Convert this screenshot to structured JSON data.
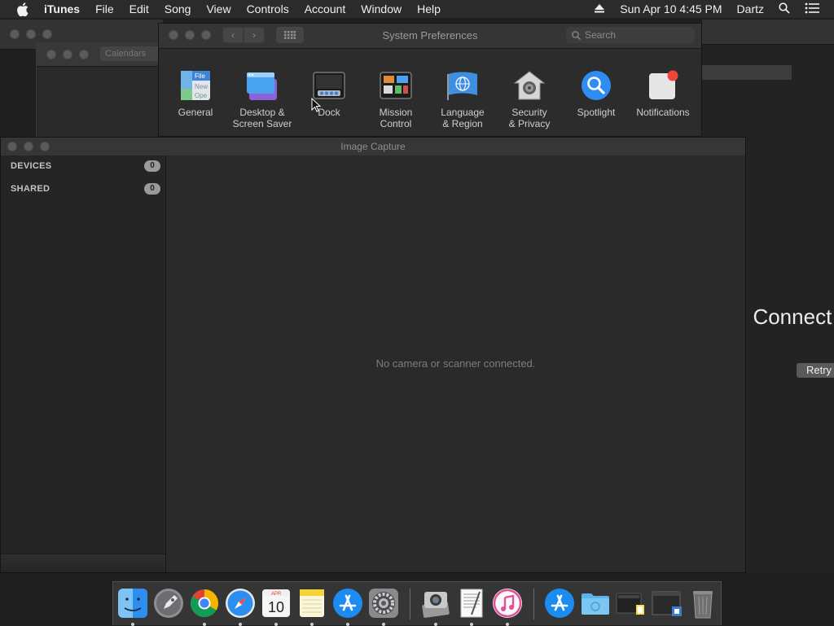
{
  "menubar": {
    "app_name": "iTunes",
    "items": [
      "File",
      "Edit",
      "Song",
      "View",
      "Controls",
      "Account",
      "Window",
      "Help"
    ],
    "datetime": "Sun Apr 10  4:45 PM",
    "user": "Dartz"
  },
  "background": {
    "calendar_field": "Calendars",
    "connect_text": ": Connect",
    "retry_label": "Retry"
  },
  "syspref": {
    "title": "System Preferences",
    "search_placeholder": "Search",
    "items": [
      {
        "label": "General",
        "icon": "general-icon"
      },
      {
        "label": "Desktop &\nScreen Saver",
        "icon": "desktop-icon"
      },
      {
        "label": "Dock",
        "icon": "dock-icon"
      },
      {
        "label": "Mission\nControl",
        "icon": "mission-control-icon"
      },
      {
        "label": "Language\n& Region",
        "icon": "language-icon"
      },
      {
        "label": "Security\n& Privacy",
        "icon": "security-icon"
      },
      {
        "label": "Spotlight",
        "icon": "spotlight-icon"
      },
      {
        "label": "Notifications",
        "icon": "notifications-icon"
      }
    ]
  },
  "imagecapture": {
    "title": "Image Capture",
    "sections": [
      {
        "label": "DEVICES",
        "count": "0"
      },
      {
        "label": "SHARED",
        "count": "0"
      }
    ],
    "empty_message": "No camera or scanner connected."
  },
  "dock": {
    "items": [
      "finder-icon",
      "launchpad-icon",
      "chrome-icon",
      "safari-icon",
      "calendar-icon",
      "notes-icon",
      "app-store-icon",
      "system-preferences-icon",
      "image-capture-icon",
      "textedit-icon",
      "itunes-icon",
      "app-store-folder-icon",
      "folder-icon",
      "screenshot-icon",
      "window-icon",
      "trash-icon"
    ],
    "calendar_month": "APR",
    "calendar_day": "10"
  }
}
